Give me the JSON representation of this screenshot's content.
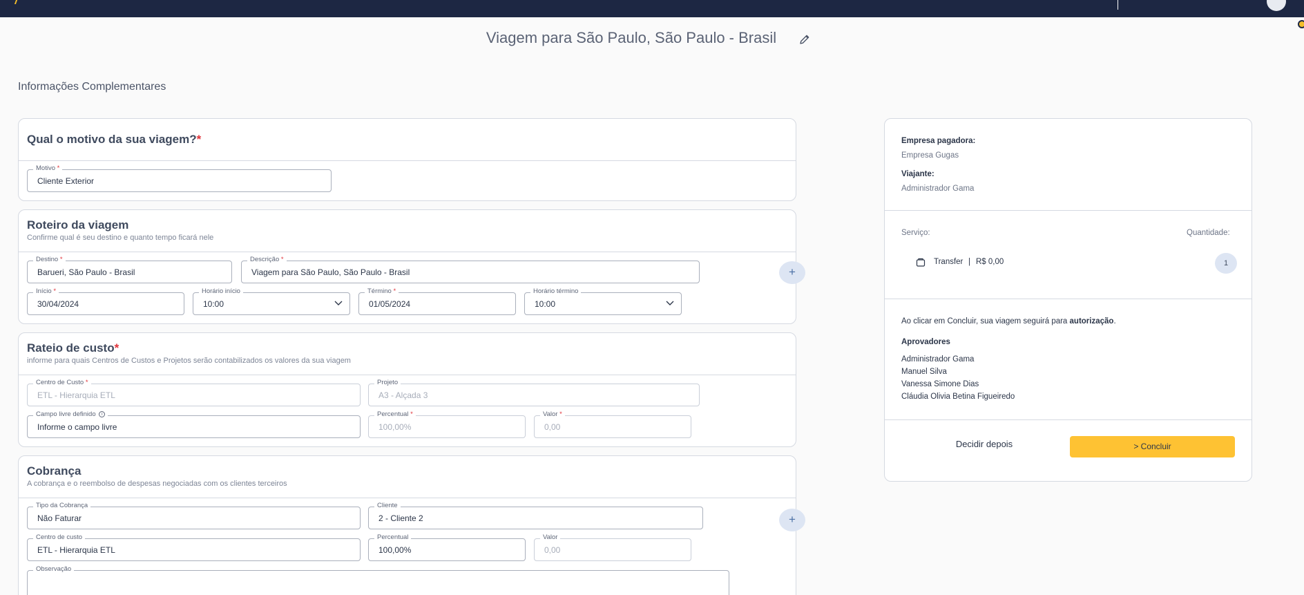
{
  "header": {
    "trip_title": "Viagem para São Paulo, São Paulo - Brasil",
    "brand_color": "#1d2743",
    "accent_color": "#fec233"
  },
  "section_title": "Informações Complementares",
  "motivo_card": {
    "title": "Qual o motivo da sua viagem?",
    "required_mark": "*",
    "motivo": {
      "label": "Motivo",
      "value": "Cliente Exterior"
    }
  },
  "roteiro_card": {
    "title": "Roteiro da viagem",
    "subtitle": "Confirme qual é seu destino e quanto tempo ficará nele",
    "destino": {
      "label": "Destino",
      "value": "Barueri, São Paulo - Brasil"
    },
    "descricao": {
      "label": "Descrição",
      "value": "Viagem para São Paulo, São Paulo - Brasil"
    },
    "inicio": {
      "label": "Início",
      "value": "30/04/2024"
    },
    "horario_inicio": {
      "label": "Horário início",
      "value": "10:00"
    },
    "termino": {
      "label": "Término",
      "value": "01/05/2024"
    },
    "horario_termino": {
      "label": "Horário término",
      "value": "10:00"
    },
    "add_label": "+"
  },
  "rateio_card": {
    "title": "Rateio de custo",
    "subtitle": "informe para quais Centros de Custos e Projetos serão contabilizados os valores da sua viagem",
    "centro_custo": {
      "label": "Centro de Custo",
      "value": "ETL - Hierarquia ETL"
    },
    "projeto": {
      "label": "Projeto",
      "value": "A3 - Alçada 3"
    },
    "campo_livre": {
      "label": "Campo livre definido",
      "info": "i",
      "value": "Informe o campo livre"
    },
    "percentual": {
      "label": "Percentual",
      "value": "100,00%"
    },
    "valor": {
      "label": "Valor",
      "value": "0,00"
    }
  },
  "cobranca_card": {
    "title": "Cobrança",
    "subtitle": "A cobrança e o reembolso de despesas negociadas com os clientes terceiros",
    "tipo": {
      "label": "Tipo da Cobrança",
      "value": "Não Faturar"
    },
    "cliente": {
      "label": "Cliente",
      "value": "2 - Cliente 2"
    },
    "centro_custo": {
      "label": "Centro de custo",
      "value": "ETL - Hierarquia ETL"
    },
    "percentual": {
      "label": "Percentual",
      "value": "100,00%"
    },
    "valor": {
      "label": "Valor",
      "value": "0,00"
    },
    "observacao": {
      "label": "Observação"
    },
    "add_label": "+"
  },
  "summary": {
    "empresa_label": "Empresa pagadora:",
    "empresa_value": "Empresa Gugas",
    "viajante_label": "Viajante:",
    "viajante_value": "Administrador Gama",
    "servico_label": "Serviço:",
    "quantidade_label": "Quantidade:",
    "service_name": "Transfer",
    "service_sep": "|",
    "service_price": "R$ 0,00",
    "service_qty": "1",
    "notice_prefix": "Ao clicar em Concluir, sua viagem seguirá para ",
    "notice_bold": "autorização",
    "notice_suffix": ".",
    "approvers_label": "Aprovadores",
    "approvers": [
      "Administrador Gama",
      "Manuel Silva",
      "Vanessa Simone Dias",
      "Cláudia Olivia Betina Figueiredo"
    ],
    "decide_later": "Decidir depois",
    "conclude": "> Concluir"
  }
}
